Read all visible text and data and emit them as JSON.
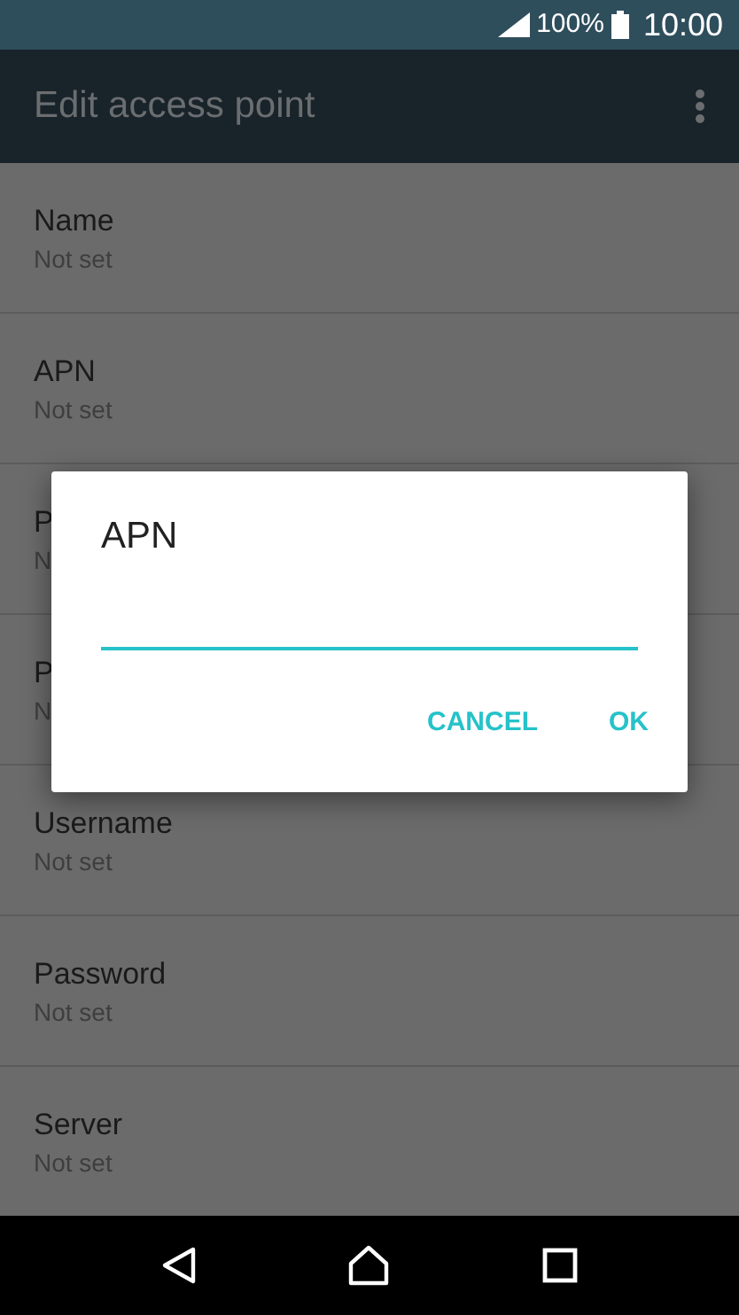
{
  "status_bar": {
    "battery": "100%",
    "time": "10:00"
  },
  "app_bar": {
    "title": "Edit access point"
  },
  "settings": [
    {
      "label": "Name",
      "value": "Not set"
    },
    {
      "label": "APN",
      "value": "Not set"
    },
    {
      "label": "P",
      "value": "N"
    },
    {
      "label": "P",
      "value": "N"
    },
    {
      "label": "Username",
      "value": "Not set"
    },
    {
      "label": "Password",
      "value": "Not set"
    },
    {
      "label": "Server",
      "value": "Not set"
    }
  ],
  "dialog": {
    "title": "APN",
    "field": {
      "focused": true
    },
    "buttons": [
      "CANCEL",
      "OK"
    ]
  }
}
